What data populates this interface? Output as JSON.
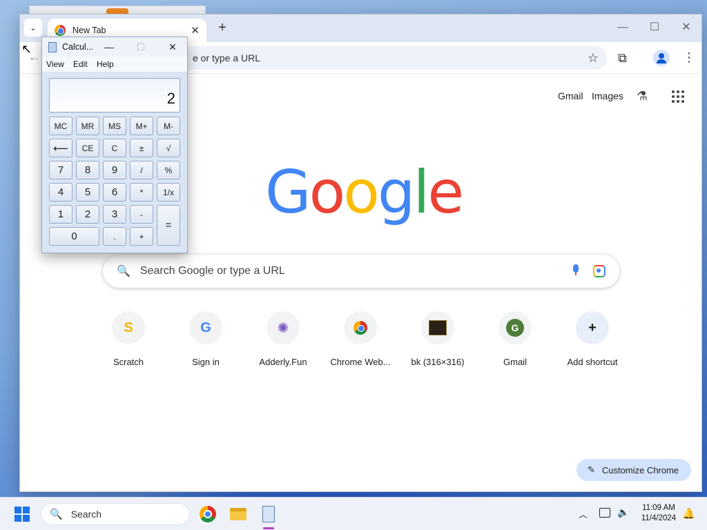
{
  "chrome": {
    "tab_search_glyph": "⌄",
    "tab": {
      "title": "New Tab",
      "close": "✕"
    },
    "new_tab": "+",
    "window_controls": {
      "minimize": "—",
      "maximize": "☐",
      "close": "✕"
    },
    "back_glyph": "←",
    "omnibox": {
      "text": "e or type a URL"
    },
    "star_glyph": "☆",
    "extensions_glyph": "⧉",
    "menu_glyph": "⋮"
  },
  "ntp": {
    "top_links": {
      "gmail": "Gmail",
      "images": "Images"
    },
    "labs_glyph": "⚗",
    "logo": [
      "G",
      "o",
      "o",
      "g",
      "l",
      "e"
    ],
    "search": {
      "glyph": "🔍",
      "placeholder": "Search Google or type a URL"
    },
    "shortcuts": [
      {
        "label": "Scratch",
        "icon": "scratch-icon",
        "glyph": "S"
      },
      {
        "label": "Sign in",
        "icon": "google-g-icon",
        "glyph": "G"
      },
      {
        "label": "Adderly.Fun",
        "icon": "adderly-icon",
        "glyph": "✺"
      },
      {
        "label": "Chrome Web...",
        "icon": "chrome-web-store-icon",
        "glyph": ""
      },
      {
        "label": "bk (316×316)",
        "icon": "bk-thumbnail-icon",
        "glyph": ""
      },
      {
        "label": "Gmail",
        "icon": "gmail-g-icon",
        "glyph": "G"
      },
      {
        "label": "Add shortcut",
        "icon": "plus-icon",
        "glyph": "+"
      }
    ],
    "customize": {
      "glyph": "✎",
      "label": "Customize Chrome"
    }
  },
  "calculator": {
    "title": "Calcul...",
    "controls": {
      "minimize": "—",
      "maximize": "☐",
      "close": "✕"
    },
    "menu": [
      "View",
      "Edit",
      "Help"
    ],
    "display": "2",
    "buttons": {
      "mc": "MC",
      "mr": "MR",
      "ms": "MS",
      "mplus": "M+",
      "mminus": "M-",
      "back": "⟵",
      "ce": "CE",
      "c": "C",
      "plusminus": "±",
      "sqrt": "√",
      "n7": "7",
      "n8": "8",
      "n9": "9",
      "div": "/",
      "pct": "%",
      "n4": "4",
      "n5": "5",
      "n6": "6",
      "mul": "*",
      "recip": "1/x",
      "n1": "1",
      "n2": "2",
      "n3": "3",
      "sub": "-",
      "eq": "=",
      "n0": "0",
      "dot": ".",
      "add": "+"
    }
  },
  "taskbar": {
    "search": {
      "glyph": "🔍",
      "label": "Search"
    },
    "tray": {
      "chevron": "︿",
      "volume_glyph": "🔈",
      "time": "11:09 AM",
      "date": "11/4/2024",
      "bell_glyph": "🔔"
    }
  },
  "cursor_glyph": "↖"
}
